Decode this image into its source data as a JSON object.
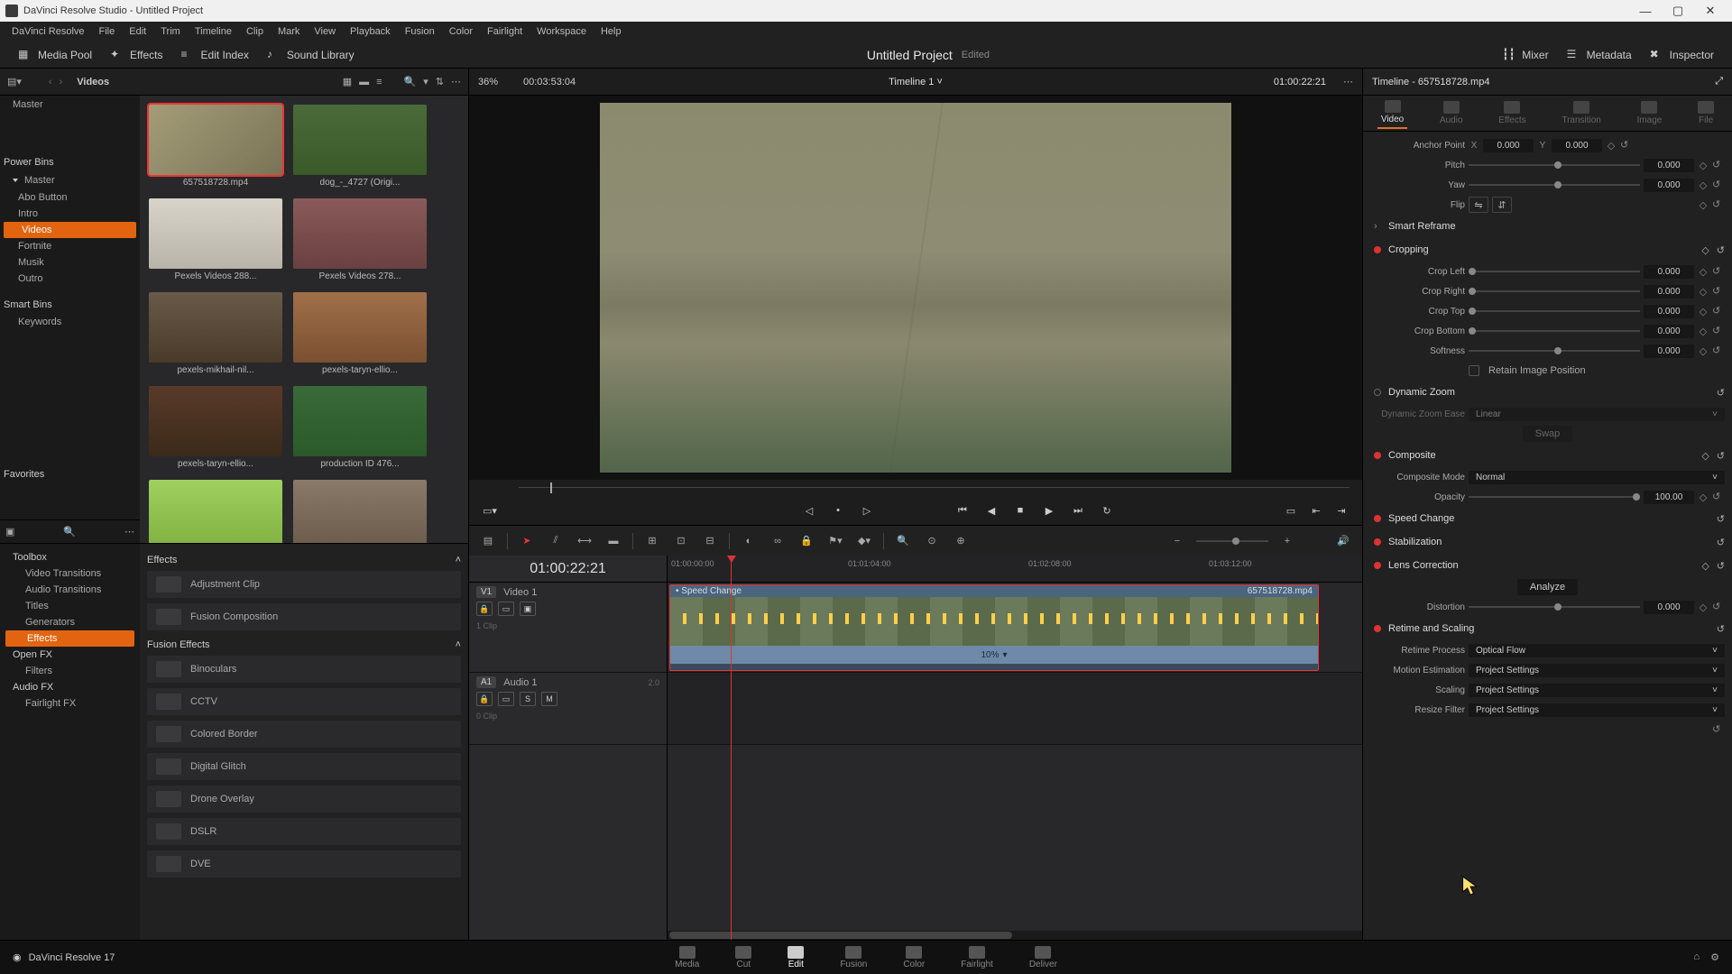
{
  "window": {
    "title": "DaVinci Resolve Studio - Untitled Project"
  },
  "menubar": [
    "DaVinci Resolve",
    "File",
    "Edit",
    "Trim",
    "Timeline",
    "Clip",
    "Mark",
    "View",
    "Playback",
    "Fusion",
    "Color",
    "Fairlight",
    "Workspace",
    "Help"
  ],
  "toptoolbar": {
    "mediapool": "Media Pool",
    "effects": "Effects",
    "editindex": "Edit Index",
    "soundlib": "Sound Library",
    "project_title": "Untitled Project",
    "project_status": "Edited",
    "mixer": "Mixer",
    "metadata": "Metadata",
    "inspector": "Inspector"
  },
  "mediapool": {
    "current_bin": "Videos",
    "zoom_pct": "36%",
    "tc": "00:03:53:04",
    "bins": {
      "root": "Master",
      "power_header": "Power Bins",
      "power_root": "Master",
      "items": [
        "Abo Button",
        "Intro",
        "Videos",
        "Fortnite",
        "Musik",
        "Outro"
      ],
      "smart_header": "Smart Bins",
      "smart_items": [
        "Keywords"
      ],
      "fav_header": "Favorites"
    },
    "clips": [
      {
        "name": "657518728.mp4",
        "sel": true
      },
      {
        "name": "dog_-_4727 (Origi...",
        "sel": false
      },
      {
        "name": "Pexels Videos 288...",
        "sel": false
      },
      {
        "name": "Pexels Videos 278...",
        "sel": false
      },
      {
        "name": "pexels-mikhail-nil...",
        "sel": false
      },
      {
        "name": "pexels-taryn-ellio...",
        "sel": false
      },
      {
        "name": "pexels-taryn-ellio...",
        "sel": false
      },
      {
        "name": "production ID 476...",
        "sel": false
      }
    ]
  },
  "fxtree": {
    "toolbox": "Toolbox",
    "items1": [
      "Video Transitions",
      "Audio Transitions",
      "Titles",
      "Generators",
      "Effects"
    ],
    "openfx": "Open FX",
    "items2": [
      "Filters"
    ],
    "audiofx": "Audio FX",
    "items3": [
      "Fairlight FX"
    ]
  },
  "fxlist": {
    "sec1": "Effects",
    "s1items": [
      "Adjustment Clip",
      "Fusion Composition"
    ],
    "sec2": "Fusion Effects",
    "s2items": [
      "Binoculars",
      "CCTV",
      "Colored Border",
      "Digital Glitch",
      "Drone Overlay",
      "DSLR",
      "DVE"
    ]
  },
  "viewer": {
    "timeline_name": "Timeline 1",
    "tc_right": "01:00:22:21"
  },
  "timeline": {
    "tc": "01:00:22:21",
    "ruler": [
      "01:00:00:00",
      "01:01:04:00",
      "01:02:08:00",
      "01:03:12:00"
    ],
    "v1": {
      "badge": "V1",
      "name": "Video 1",
      "clipcount": "1 Clip"
    },
    "a1": {
      "badge": "A1",
      "name": "Audio 1",
      "meters": "2.0",
      "clipcount": "0 Clip"
    },
    "clip": {
      "badge_left": "Speed Change",
      "name": "657518728.mp4",
      "speed": "10%"
    }
  },
  "inspector": {
    "title": "Timeline - 657518728.mp4",
    "tabs": [
      "Video",
      "Audio",
      "Effects",
      "Transition",
      "Image",
      "File"
    ],
    "anchor": {
      "label": "Anchor Point",
      "x": "0.000",
      "y": "0.000"
    },
    "pitch": {
      "label": "Pitch",
      "val": "0.000"
    },
    "yaw": {
      "label": "Yaw",
      "val": "0.000"
    },
    "flip": {
      "label": "Flip"
    },
    "smart_reframe": "Smart Reframe",
    "cropping": {
      "title": "Cropping",
      "left": {
        "label": "Crop Left",
        "val": "0.000"
      },
      "right": {
        "label": "Crop Right",
        "val": "0.000"
      },
      "top": {
        "label": "Crop Top",
        "val": "0.000"
      },
      "bottom": {
        "label": "Crop Bottom",
        "val": "0.000"
      },
      "soft": {
        "label": "Softness",
        "val": "0.000"
      },
      "retain": "Retain Image Position"
    },
    "dynzoom": {
      "title": "Dynamic Zoom",
      "ease_lbl": "Dynamic Zoom Ease",
      "ease_val": "Linear",
      "swap": "Swap"
    },
    "composite": {
      "title": "Composite",
      "mode_lbl": "Composite Mode",
      "mode_val": "Normal",
      "opacity_lbl": "Opacity",
      "opacity_val": "100.00"
    },
    "speed_change": "Speed Change",
    "stabilization": "Stabilization",
    "lenscorr": {
      "title": "Lens Correction",
      "analyze": "Analyze",
      "distortion_lbl": "Distortion",
      "distortion_val": "0.000"
    },
    "retime": {
      "title": "Retime and Scaling",
      "process_lbl": "Retime Process",
      "process_val": "Optical Flow",
      "me_lbl": "Motion Estimation",
      "me_val": "Project Settings",
      "scaling_lbl": "Scaling",
      "scaling_val": "Project Settings",
      "resize_lbl": "Resize Filter",
      "resize_val": "Project Settings"
    }
  },
  "pages": [
    "Media",
    "Cut",
    "Edit",
    "Fusion",
    "Color",
    "Fairlight",
    "Deliver"
  ],
  "status": {
    "version": "DaVinci Resolve 17"
  }
}
